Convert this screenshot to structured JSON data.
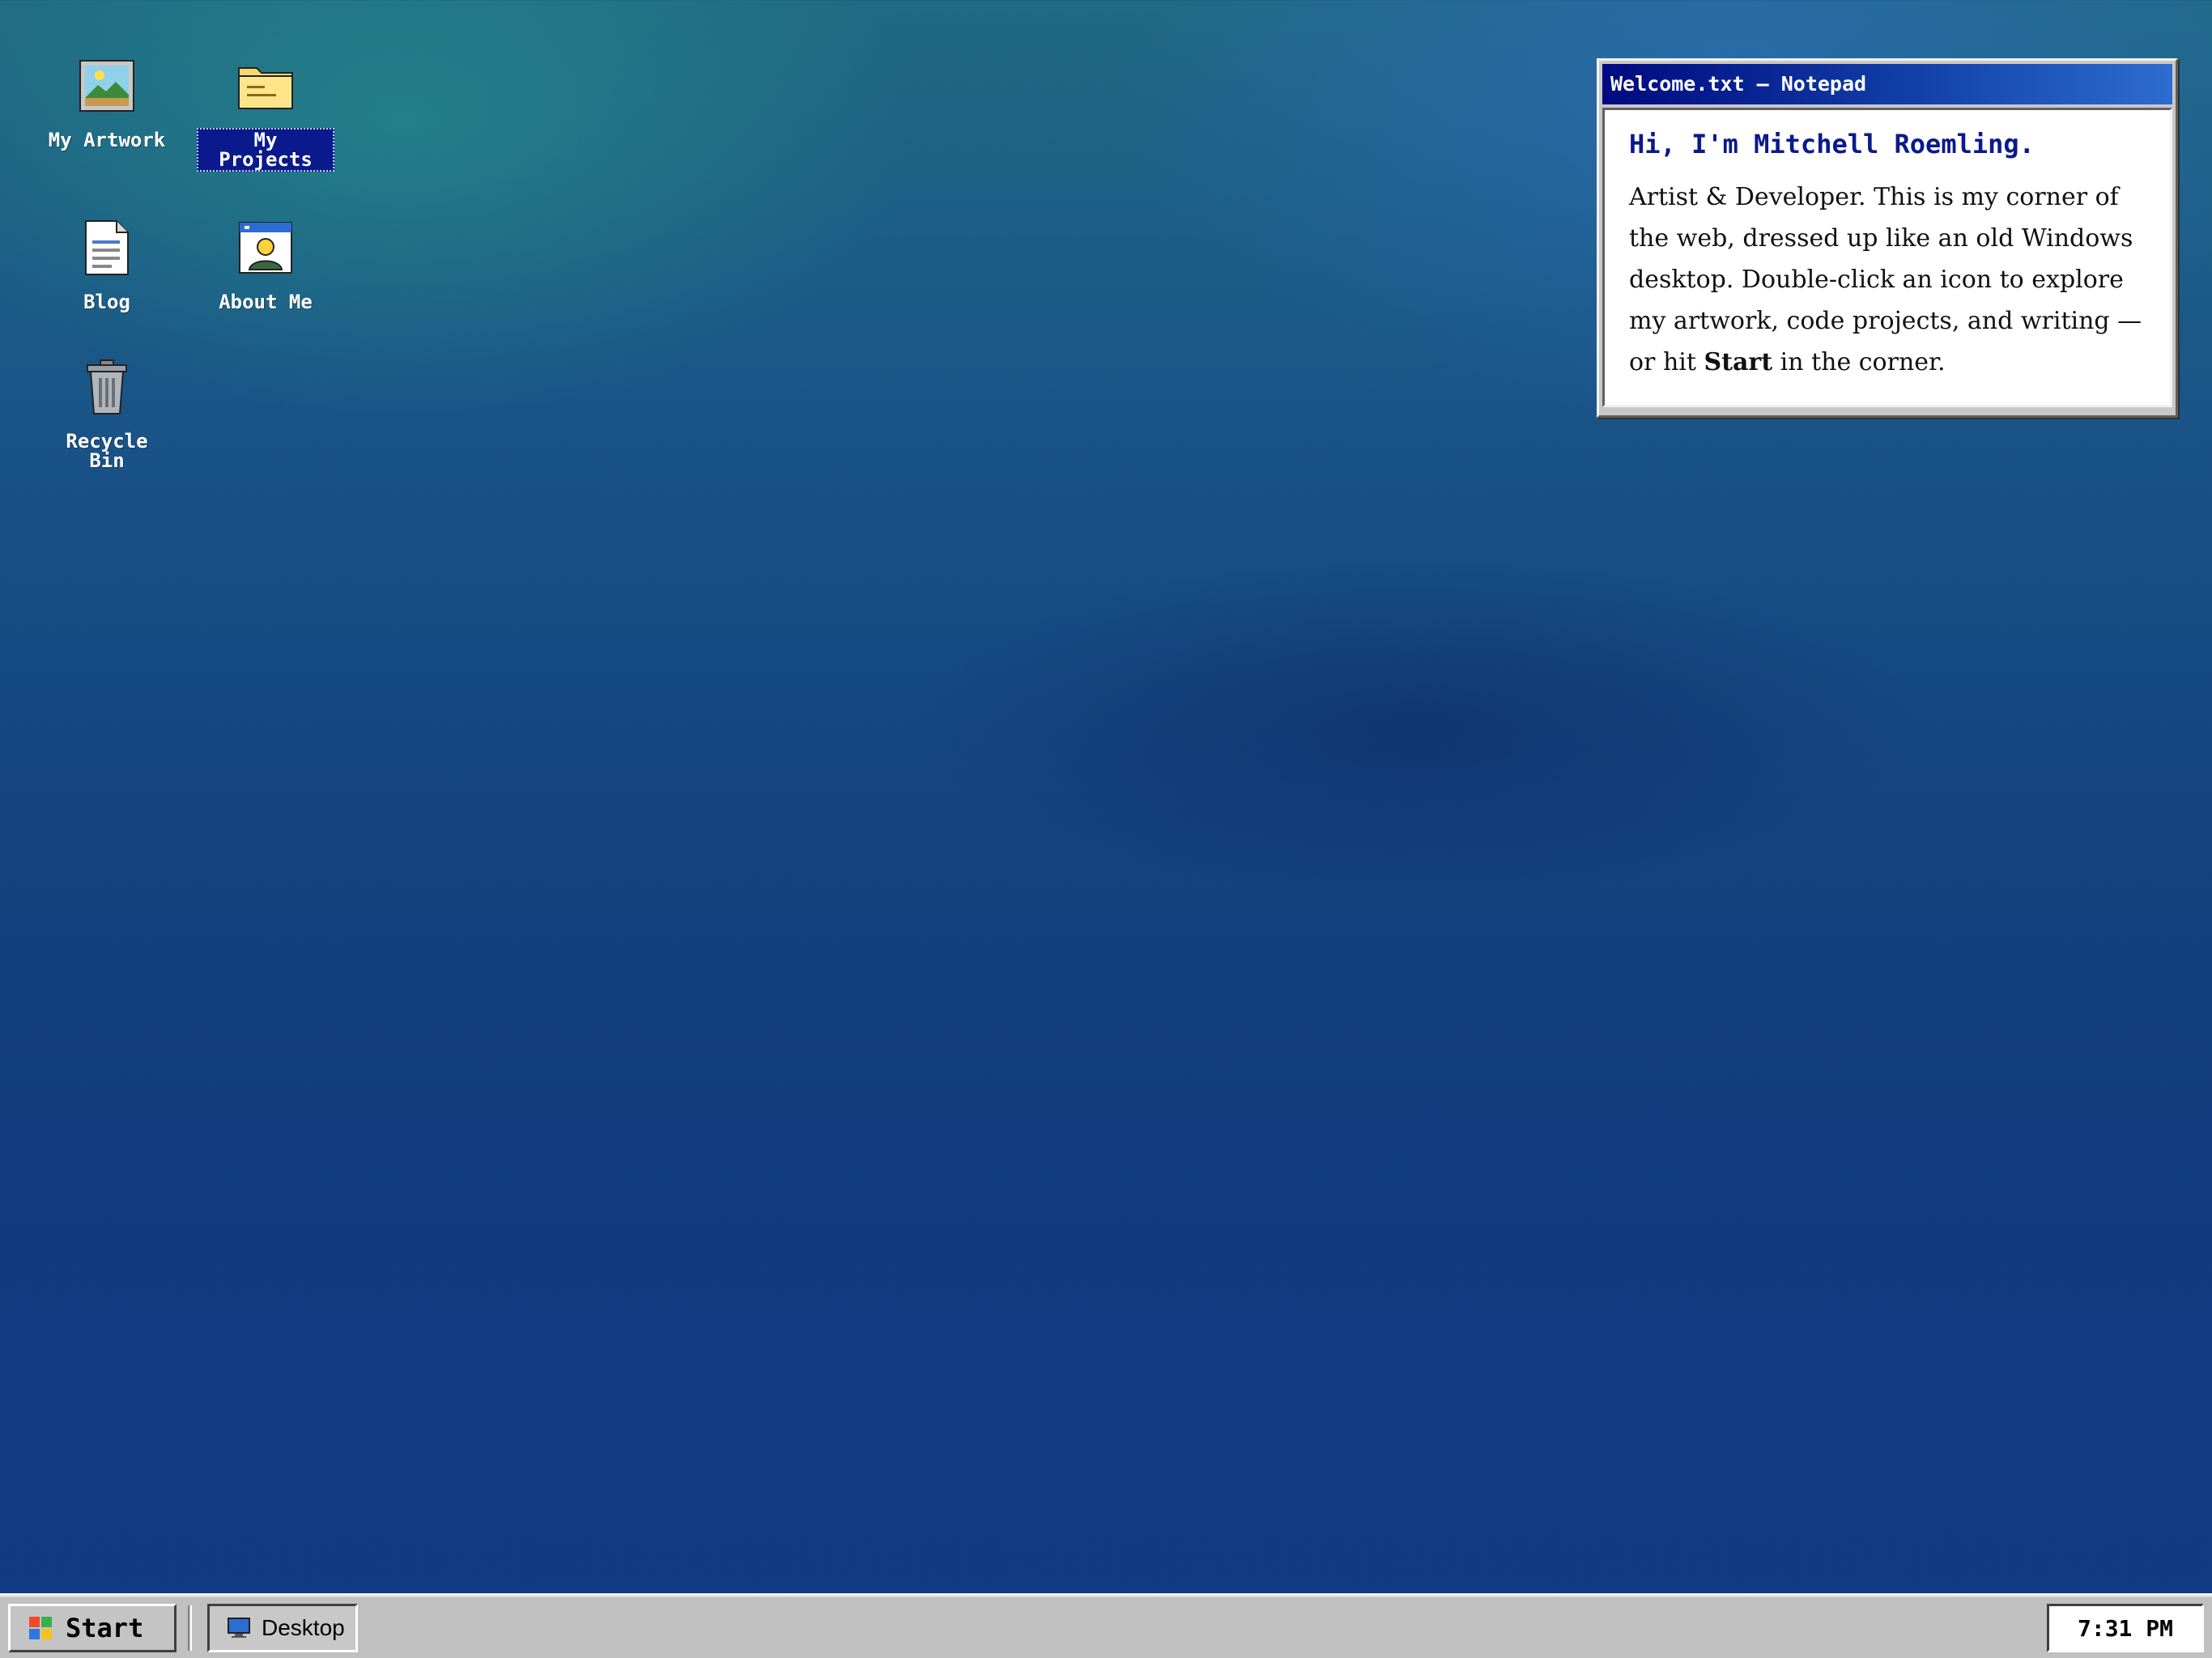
{
  "desktop": {
    "icons": [
      {
        "label": "My Artwork",
        "icon": "picture-icon"
      },
      {
        "label": "My Projects",
        "icon": "folder-icon",
        "selected": true
      },
      {
        "label": "Blog",
        "icon": "document-icon"
      },
      {
        "label": "About Me",
        "icon": "contact-card-icon"
      },
      {
        "label": "Recycle Bin",
        "icon": "trash-icon"
      }
    ]
  },
  "notepad": {
    "title": "Welcome.txt — Notepad",
    "heading": "Hi, I'm Mitchell Roemling.",
    "body_main": "Artist & Developer. This is my corner of the web, dressed up like an old Windows desktop. Double-click an icon to explore my artwork, code projects, and writing — or hit ",
    "body_bold": "Start",
    "body_tail": " in the corner."
  },
  "taskbar": {
    "start_label": "Start",
    "tasks": [
      {
        "label": "Desktop",
        "icon": "monitor-icon"
      }
    ],
    "clock": "7:31 PM"
  },
  "colors": {
    "titlebar_start": "#000a80",
    "titlebar_end": "#2d6cd0",
    "heading": "#0a1a8c",
    "taskbar": "#c0c0c0"
  }
}
